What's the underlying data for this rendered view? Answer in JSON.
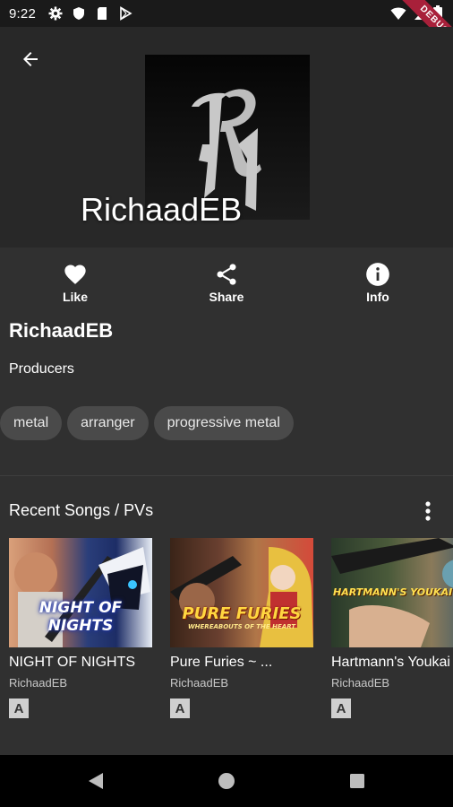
{
  "status_bar": {
    "time": "9:22",
    "debug_label": "DEBUG"
  },
  "header": {
    "title": "RichaadEB"
  },
  "actions": [
    {
      "label": "Like",
      "icon": "heart-icon"
    },
    {
      "label": "Share",
      "icon": "share-icon"
    },
    {
      "label": "Info",
      "icon": "info-icon"
    }
  ],
  "artist": {
    "name": "RichaadEB",
    "type": "Producers",
    "tags": [
      "metal",
      "arranger",
      "progressive metal"
    ]
  },
  "recent": {
    "title": "Recent Songs / PVs",
    "songs": [
      {
        "title": "NIGHT OF NIGHTS",
        "artist": "RichaadEB",
        "badge": "A",
        "thumb_caption": "NIGHT OF NIGHTS"
      },
      {
        "title": "Pure Furies ~ ...",
        "artist": "RichaadEB",
        "badge": "A",
        "thumb_caption": "PURE FURIES",
        "thumb_subcaption": "WHEREABOUTS OF THE HEART"
      },
      {
        "title": "Hartmann's Youkai",
        "artist": "RichaadEB",
        "badge": "A",
        "thumb_caption": "HARTMANN'S YOUKAI G"
      }
    ]
  },
  "colors": {
    "background": "#303030",
    "header": "#282828",
    "chip": "#4a4a4a",
    "nav": "#000000",
    "debug_ribbon": "#a8203a"
  }
}
